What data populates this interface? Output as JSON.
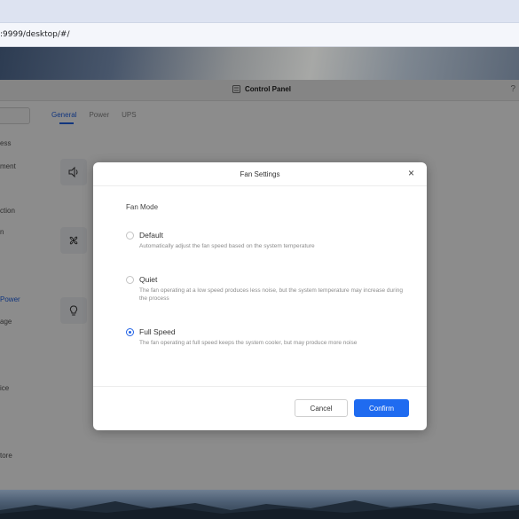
{
  "browser": {
    "address": ":9999/desktop/#/"
  },
  "window": {
    "title": "Control Panel",
    "help": "?"
  },
  "sidebar": {
    "items": [
      {
        "label": "ess"
      },
      {
        "label": "ment"
      },
      {
        "label": "ction"
      },
      {
        "label": "n"
      },
      {
        "label": "Power"
      },
      {
        "label": "age"
      },
      {
        "label": "ice"
      },
      {
        "label": "tore"
      }
    ]
  },
  "tabs": [
    {
      "label": "General"
    },
    {
      "label": "Power"
    },
    {
      "label": "UPS"
    }
  ],
  "modal": {
    "title": "Fan Settings",
    "close": "×",
    "section_label": "Fan Mode",
    "options": [
      {
        "title": "Default",
        "desc": "Automatically adjust the fan speed based on the system temperature",
        "checked": false
      },
      {
        "title": "Quiet",
        "desc": "The fan operating at a low speed produces less noise, but the system temperature may increase during the process",
        "checked": false
      },
      {
        "title": "Full Speed",
        "desc": "The fan operating at full speed keeps the system cooler, but may produce more noise",
        "checked": true
      }
    ],
    "cancel_label": "Cancel",
    "confirm_label": "Confirm"
  },
  "colors": {
    "accent": "#2263e6",
    "confirm_bg": "#1f6bf0"
  }
}
